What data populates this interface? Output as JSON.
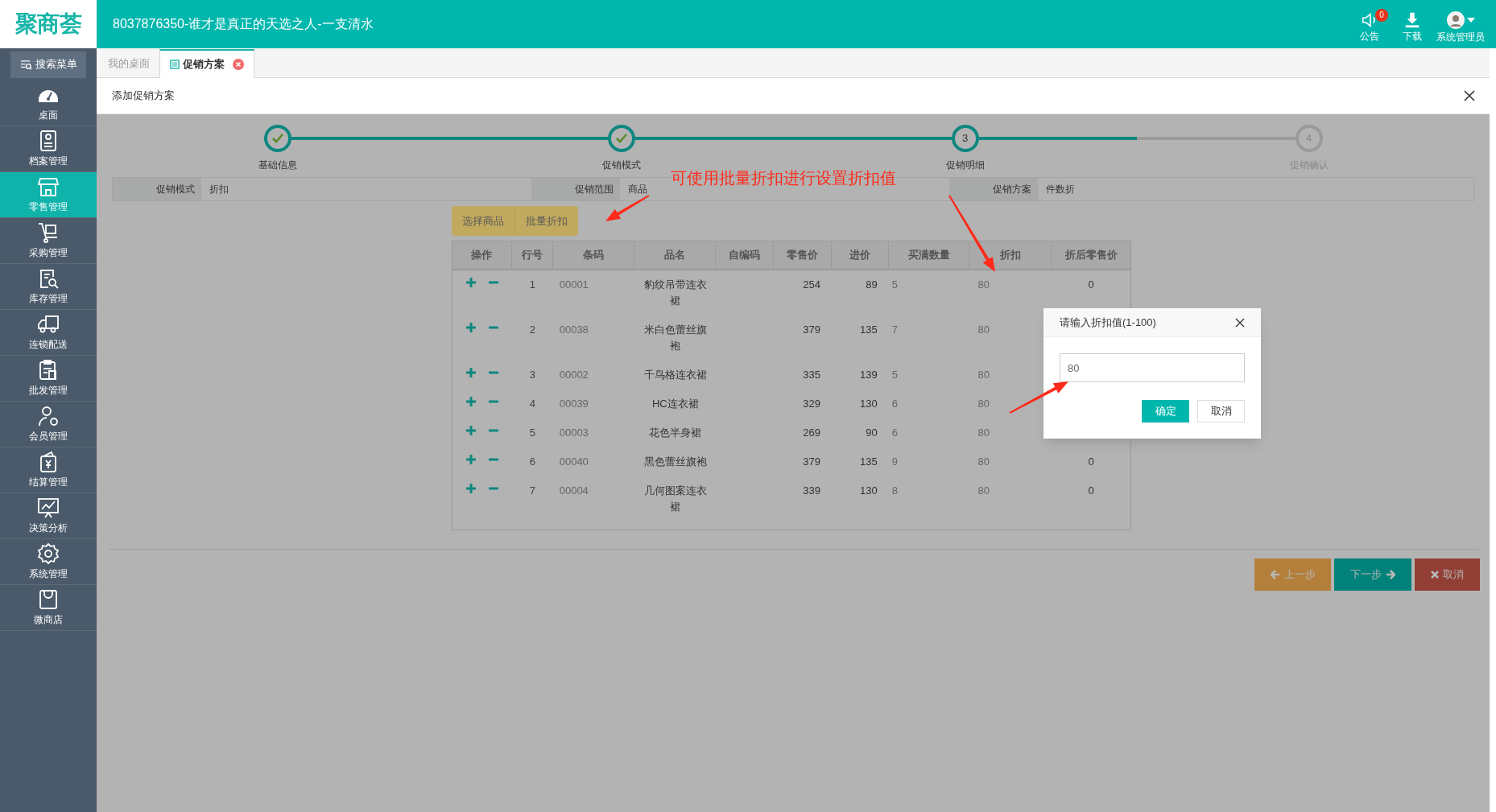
{
  "header": {
    "logo": "聚商荟",
    "title": "8037876350-谁才是真正的天选之人-一支清水",
    "actions": [
      {
        "kind": "notice",
        "label": "公告",
        "badge": "0"
      },
      {
        "kind": "download",
        "label": "下载"
      },
      {
        "kind": "user",
        "label": "系统管理员"
      }
    ]
  },
  "sidebar": {
    "search": "搜索菜单",
    "items": [
      {
        "label": "桌面",
        "selected": false
      },
      {
        "label": "档案管理",
        "selected": false
      },
      {
        "label": "零售管理",
        "selected": true
      },
      {
        "label": "采购管理",
        "selected": false
      },
      {
        "label": "库存管理",
        "selected": false
      },
      {
        "label": "连锁配送",
        "selected": false
      },
      {
        "label": "批发管理",
        "selected": false
      },
      {
        "label": "会员管理",
        "selected": false
      },
      {
        "label": "结算管理",
        "selected": false
      },
      {
        "label": "决策分析",
        "selected": false
      },
      {
        "label": "系统管理",
        "selected": false
      },
      {
        "label": "微商店",
        "selected": false
      }
    ]
  },
  "tabs": [
    {
      "label": "我的桌面",
      "selected": false,
      "closable": false
    },
    {
      "label": "促销方案",
      "selected": true,
      "closable": true
    }
  ],
  "panel": {
    "title": "添加促销方案",
    "steps": [
      {
        "label": "基础信息",
        "kind": "done"
      },
      {
        "label": "促销模式",
        "kind": "done"
      },
      {
        "label": "促销明细",
        "kind": "current",
        "number": "3"
      },
      {
        "label": "促销确认",
        "kind": "pending",
        "number": "4"
      }
    ],
    "info": [
      {
        "label": "促销模式",
        "value": "折扣"
      },
      {
        "label": "促销范围",
        "value": "商品"
      },
      {
        "label": "促销方案",
        "value": "件数折"
      }
    ],
    "toolbar": [
      "选择商品",
      "批量折扣"
    ],
    "table": {
      "columns": [
        "操作",
        "行号",
        "条码",
        "品名",
        "自编码",
        "零售价",
        "进价",
        "买满数量",
        "折扣",
        "折后零售价"
      ],
      "rows": [
        [
          "",
          "1",
          "00001",
          "豹纹吊带连衣裙",
          "",
          "254",
          "89",
          "5",
          "80",
          "0"
        ],
        [
          "",
          "2",
          "00038",
          "米白色蕾丝旗袍",
          "",
          "379",
          "135",
          "7",
          "80"
        ],
        [
          "",
          "3",
          "00002",
          "千鸟格连衣裙",
          "",
          "335",
          "139",
          "5",
          "80"
        ],
        [
          "",
          "4",
          "00039",
          "HC连衣裙",
          "",
          "329",
          "130",
          "6",
          "80"
        ],
        [
          "",
          "5",
          "00003",
          "花色半身裙",
          "",
          "269",
          "90",
          "6",
          "80"
        ],
        [
          "",
          "6",
          "00040",
          "黑色蕾丝旗袍",
          "",
          "379",
          "135",
          "9",
          "80",
          "0"
        ],
        [
          "",
          "7",
          "00004",
          "几何图案连衣裙",
          "",
          "339",
          "130",
          "8",
          "80",
          "0"
        ]
      ]
    },
    "buttons": [
      {
        "kind": "prev",
        "label": "上一步"
      },
      {
        "kind": "next",
        "label": "下一步"
      },
      {
        "kind": "cancel",
        "label": "取消"
      }
    ]
  },
  "dialog": {
    "title": "请输入折扣值(1-100)",
    "value": "80",
    "buttons": [
      {
        "kind": "primary",
        "label": "确定"
      },
      {
        "kind": "default",
        "label": "取消"
      }
    ]
  },
  "annotation": {
    "text": "可使用批量折扣进行设置折扣值"
  }
}
